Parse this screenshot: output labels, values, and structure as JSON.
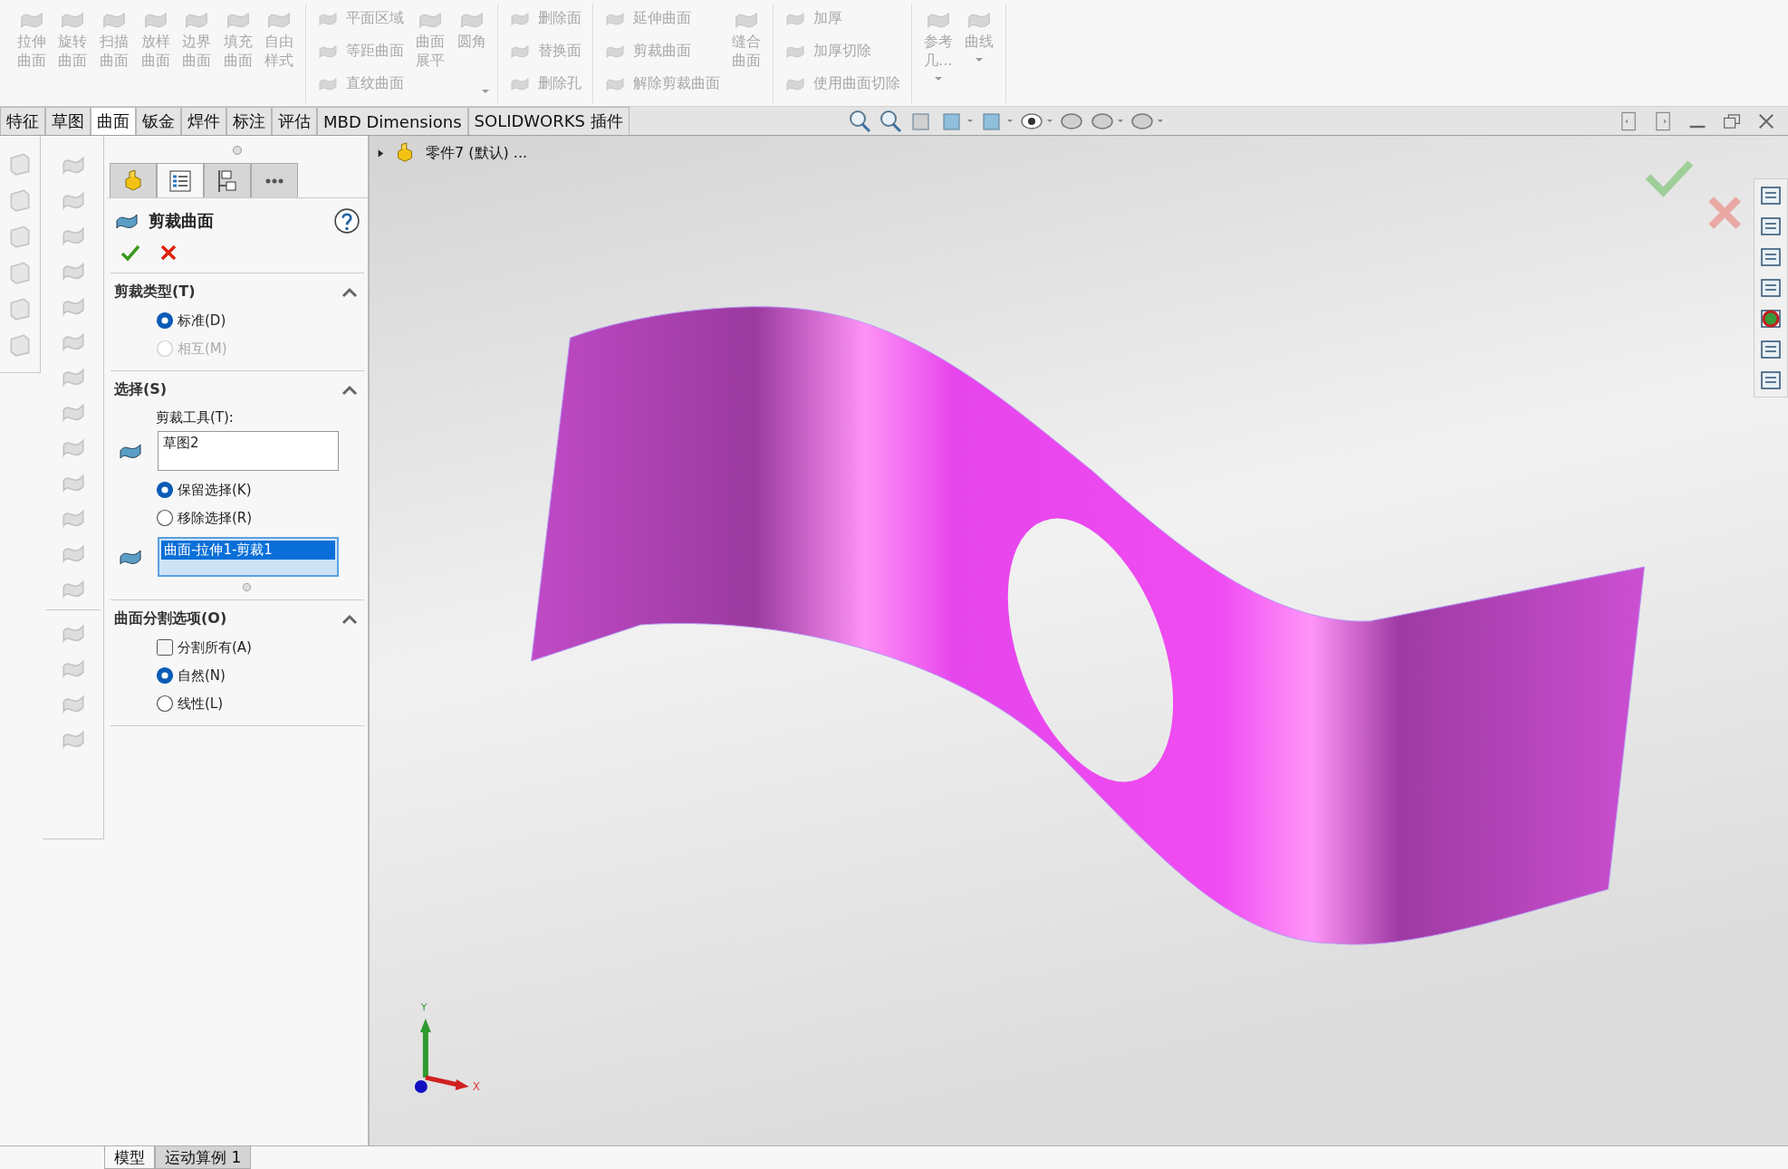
{
  "ribbon": [
    {
      "columns": [
        {
          "kind": "large",
          "label": "拉伸曲面"
        },
        {
          "kind": "large",
          "label": "旋转曲面"
        },
        {
          "kind": "large",
          "label": "扫描曲面"
        },
        {
          "kind": "large",
          "label": "放样曲面"
        },
        {
          "kind": "large",
          "label": "边界曲面"
        },
        {
          "kind": "large",
          "label": "填充曲面"
        },
        {
          "kind": "large",
          "label": "自由样式"
        }
      ]
    },
    {
      "dropdown": true,
      "columns": [
        {
          "kind": "stack",
          "items": [
            "平面区域",
            "等距曲面",
            "直纹曲面"
          ]
        },
        {
          "kind": "large",
          "label": "曲面展平"
        },
        {
          "kind": "large",
          "label": "圆角"
        }
      ]
    },
    {
      "columns": [
        {
          "kind": "stack",
          "items": [
            "删除面",
            "替换面",
            "删除孔"
          ]
        }
      ]
    },
    {
      "columns": [
        {
          "kind": "stack",
          "items": [
            "延伸曲面",
            "剪裁曲面",
            "解除剪裁曲面"
          ]
        },
        {
          "kind": "large",
          "label": "缝合曲面"
        }
      ]
    },
    {
      "columns": [
        {
          "kind": "stack",
          "items": [
            "加厚",
            "加厚切除",
            "使用曲面切除"
          ]
        }
      ]
    },
    {
      "columns": [
        {
          "kind": "large",
          "label": "参考几...",
          "dropdown": true
        },
        {
          "kind": "large",
          "label": "曲线",
          "dropdown": true
        }
      ]
    }
  ],
  "tabs": [
    {
      "label": "特征",
      "selected": false
    },
    {
      "label": "草图",
      "selected": false
    },
    {
      "label": "曲面",
      "selected": true
    },
    {
      "label": "钣金",
      "selected": false
    },
    {
      "label": "焊件",
      "selected": false
    },
    {
      "label": "标注",
      "selected": false
    },
    {
      "label": "评估",
      "selected": false
    },
    {
      "label": "MBD Dimensions",
      "selected": false
    },
    {
      "label": "SOLIDWORKS 插件",
      "selected": false
    }
  ],
  "panel": {
    "tabs": [
      {
        "selected": false
      },
      {
        "selected": true
      },
      {
        "selected": false
      },
      {
        "selected": false
      }
    ],
    "title": "剪裁曲面",
    "sections": [
      {
        "title": "剪裁类型(T)",
        "expanded": true,
        "items": [
          {
            "kind": "radio",
            "label": "标准(D)",
            "selected": true,
            "disabled": false
          },
          {
            "kind": "radio",
            "label": "相互(M)",
            "selected": false,
            "disabled": true
          }
        ]
      },
      {
        "title": "选择(S)",
        "expanded": true,
        "items": [
          {
            "kind": "label",
            "label": "剪裁工具(T):"
          },
          {
            "kind": "list",
            "entries": [
              {
                "text": "草图2",
                "selected": false
              }
            ]
          },
          {
            "kind": "radio",
            "label": "保留选择(K)",
            "selected": true,
            "disabled": false
          },
          {
            "kind": "radio",
            "label": "移除选择(R)",
            "selected": false,
            "disabled": false
          },
          {
            "kind": "list",
            "entries": [
              {
                "text": "曲面-拉伸1-剪裁1",
                "selected": true
              }
            ]
          }
        ]
      },
      {
        "title": "曲面分割选项(O)",
        "expanded": true,
        "items": [
          {
            "kind": "checkbox",
            "label": "分割所有(A)",
            "checked": false
          },
          {
            "kind": "radio",
            "label": "自然(N)",
            "selected": true,
            "disabled": false
          },
          {
            "kind": "radio",
            "label": "线性(L)",
            "selected": false,
            "disabled": false
          }
        ]
      }
    ]
  },
  "tree_header": {
    "label": "零件7 (默认) ...",
    "expanded": false
  },
  "triad": {
    "x_label": "X",
    "y_label": "Y"
  },
  "bottom_tabs": [
    {
      "label": "模型",
      "selected": true
    },
    {
      "label": "运动算例 1",
      "selected": false
    }
  ]
}
